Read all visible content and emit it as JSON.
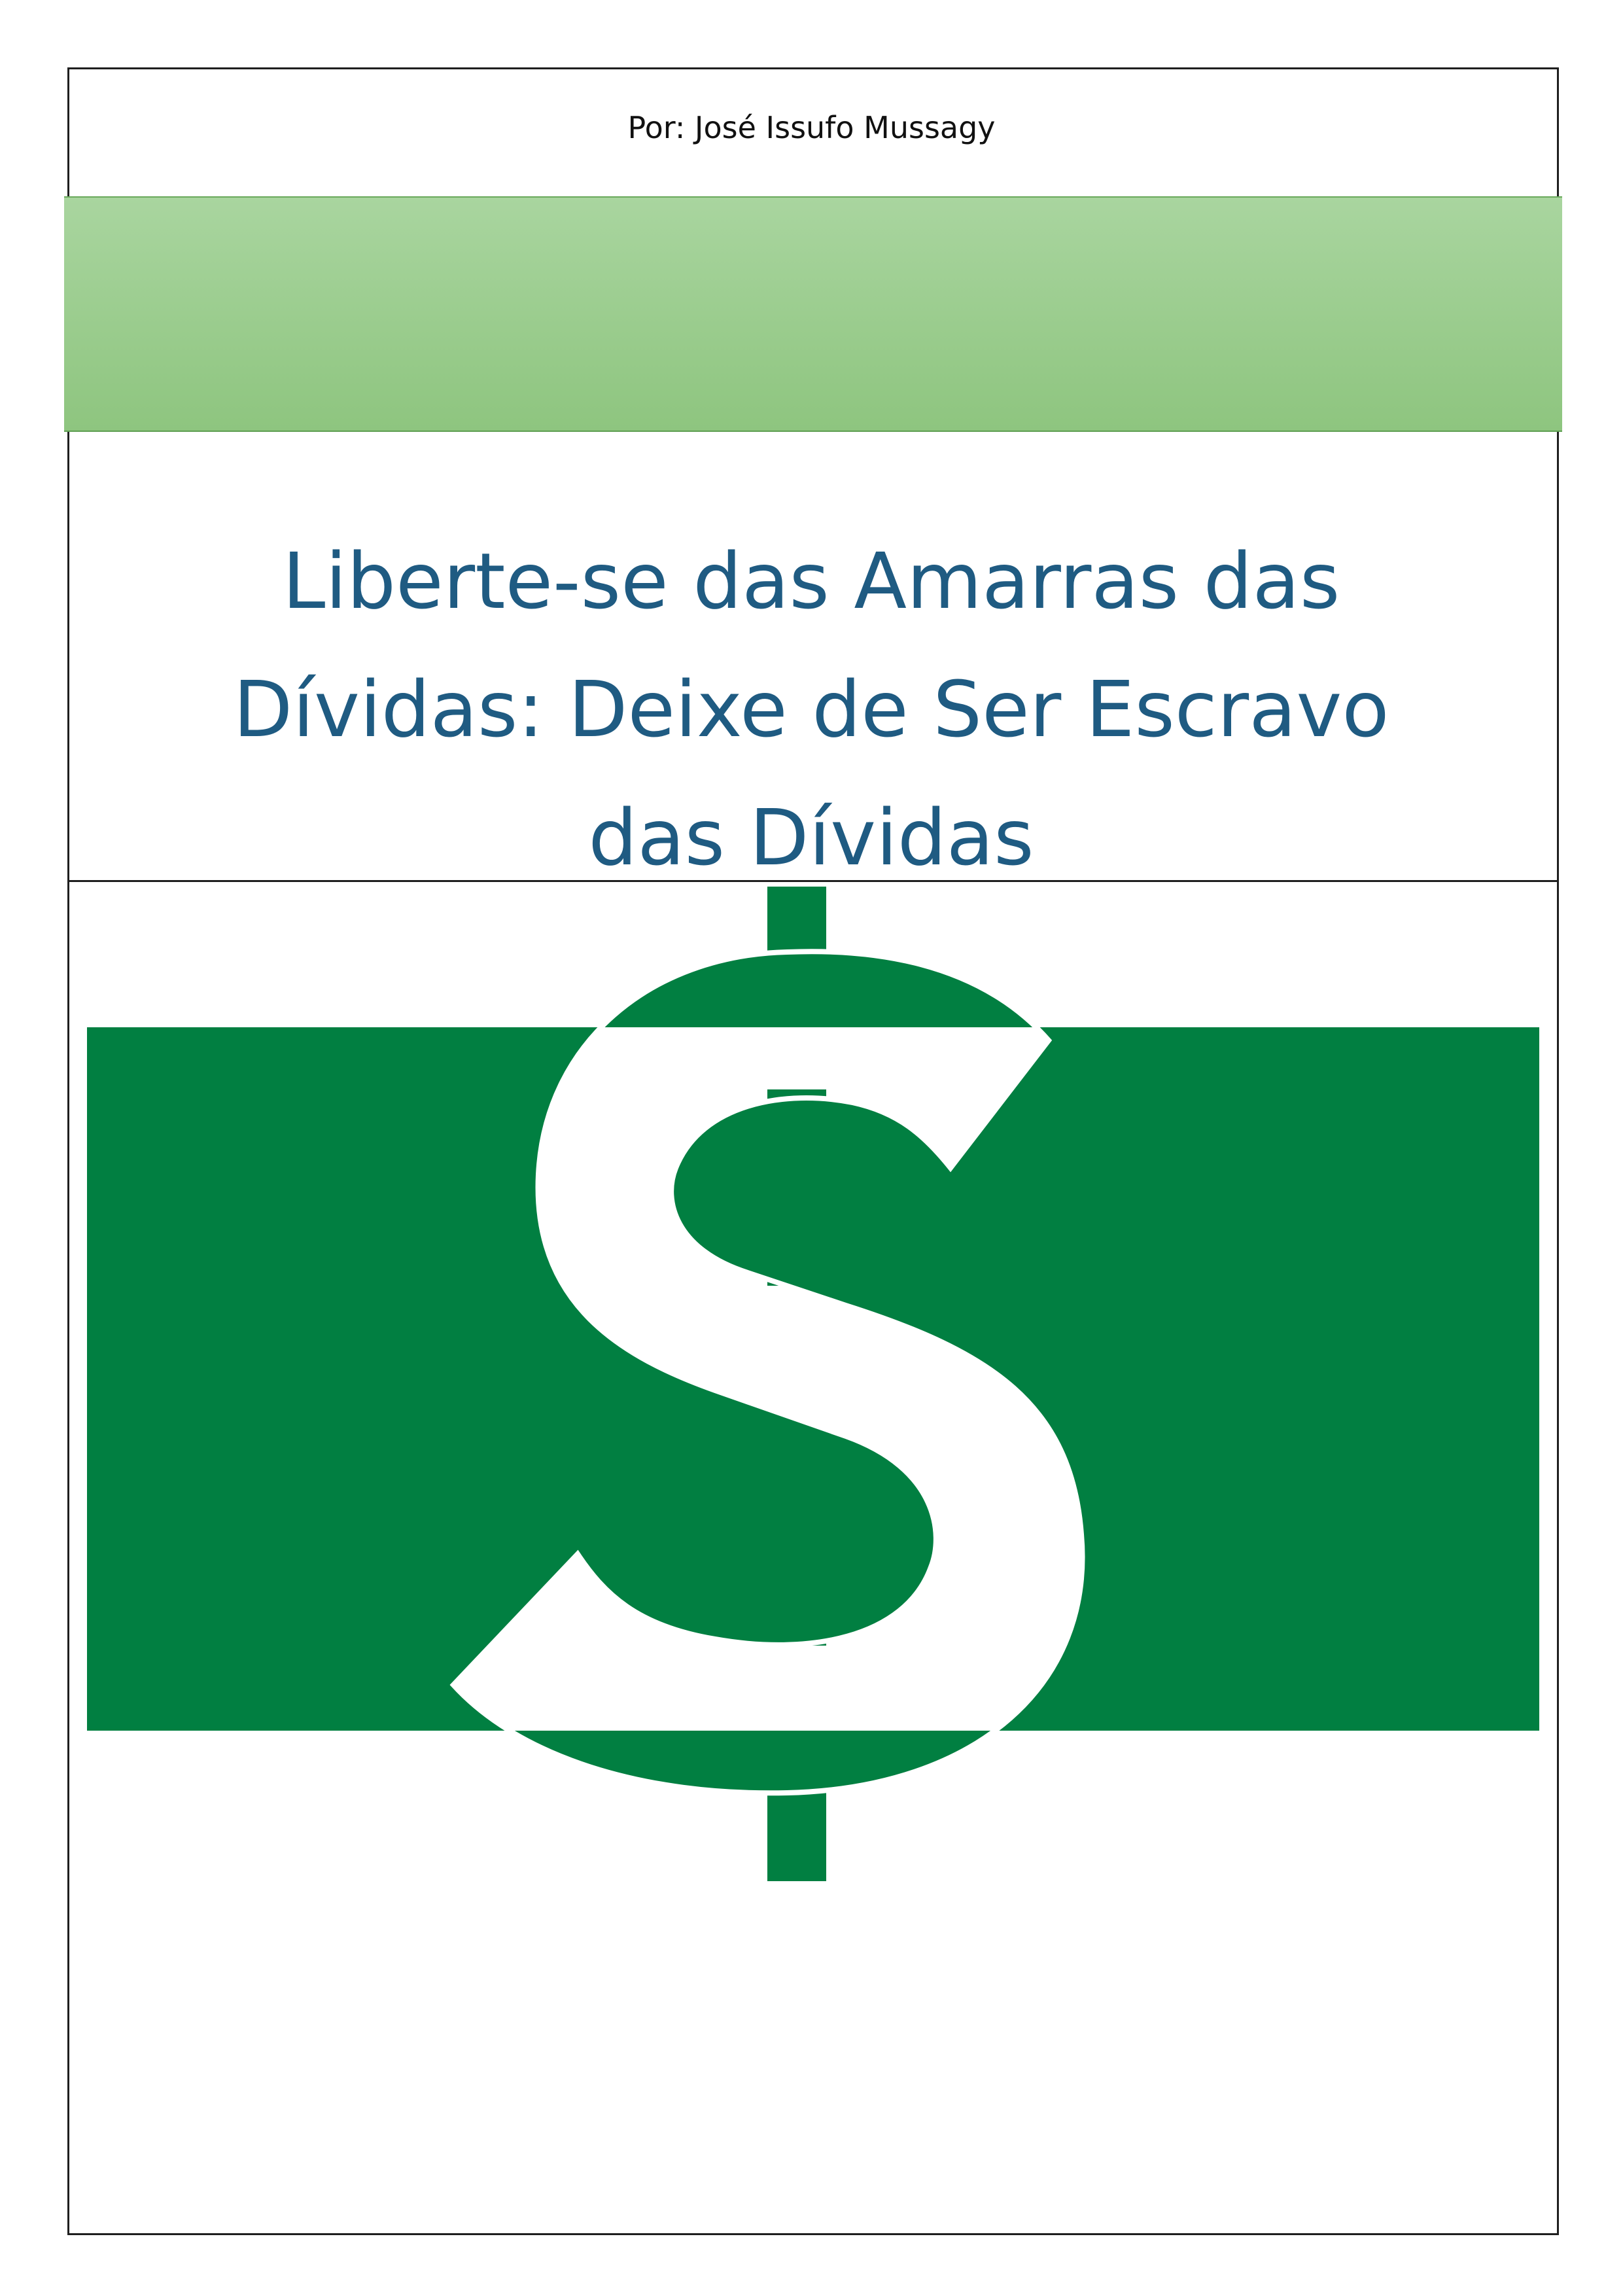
{
  "document": {
    "author_line": "Por: José Issufo Mussagy",
    "title": "Liberte-se das Amarras das Dívidas: Deixe de Ser Escravo das Dívidas"
  },
  "cover_art": {
    "icon": "dollar-sign-icon",
    "banner_color": "#017f41",
    "symbol_color": "#ffffff",
    "header_band_color": "#9ccd8f",
    "title_color": "#1f5b82"
  }
}
